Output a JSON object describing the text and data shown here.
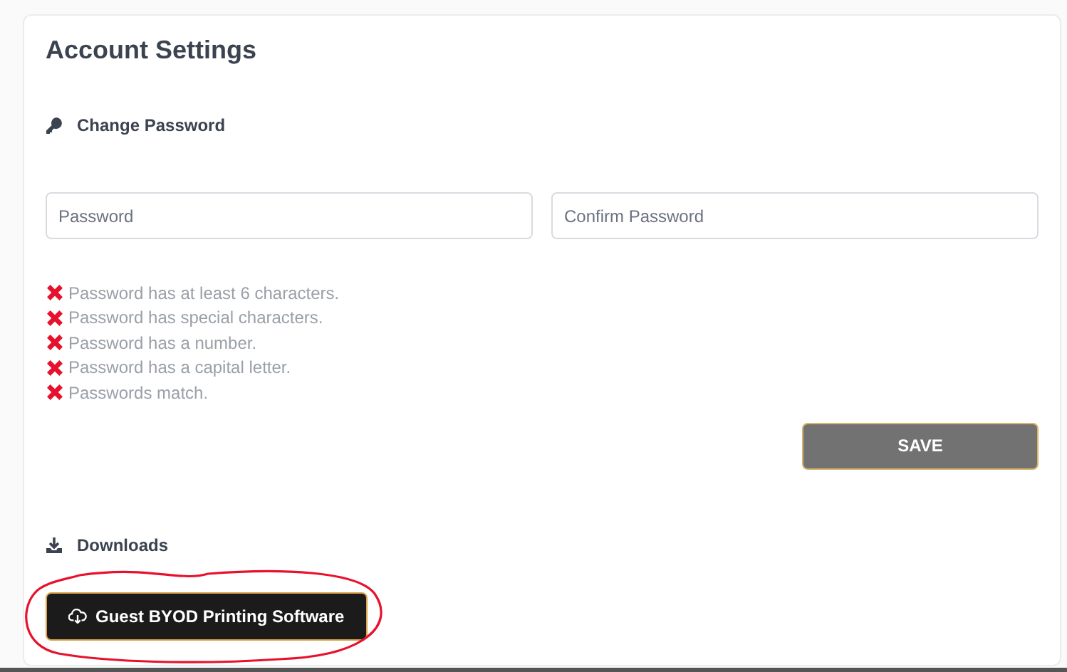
{
  "title": "Account Settings",
  "password_section": {
    "heading": "Change Password",
    "fields": [
      {
        "placeholder": "Password"
      },
      {
        "placeholder": "Confirm Password"
      }
    ],
    "requirements": [
      {
        "text": "Password has at least 6 characters.",
        "met": false
      },
      {
        "text": "Password has special characters.",
        "met": false
      },
      {
        "text": "Password has a number.",
        "met": false
      },
      {
        "text": "Password has a capital letter.",
        "met": false
      },
      {
        "text": "Passwords match.",
        "met": false
      }
    ],
    "save_button": {
      "label": "SAVE",
      "disabled": true
    }
  },
  "downloads_section": {
    "heading": "Downloads",
    "buttons": [
      {
        "label": "Guest BYOD Printing Software",
        "highlighted": true
      }
    ]
  }
}
